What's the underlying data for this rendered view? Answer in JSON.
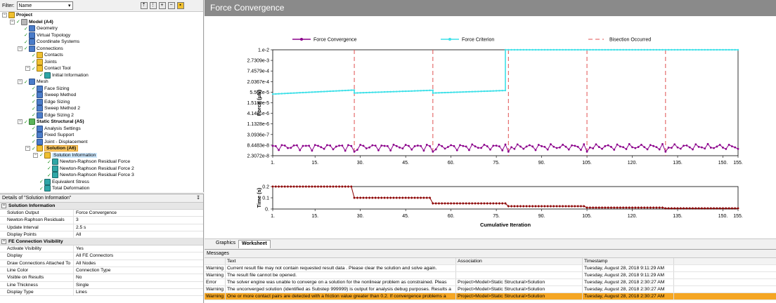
{
  "filter": {
    "label": "Filter:",
    "value": "Name"
  },
  "tree": [
    {
      "label": "Project",
      "depth": 0,
      "icon": "yellow",
      "bold": true
    },
    {
      "label": "Model (A4)",
      "depth": 1,
      "icon": "gray",
      "bold": true
    },
    {
      "label": "Geometry",
      "depth": 2,
      "icon": "blue"
    },
    {
      "label": "Virtual Topology",
      "depth": 2,
      "icon": "blue"
    },
    {
      "label": "Coordinate Systems",
      "depth": 2,
      "icon": "blue"
    },
    {
      "label": "Connections",
      "depth": 2,
      "icon": "blue"
    },
    {
      "label": "Contacts",
      "depth": 3,
      "icon": "yellow"
    },
    {
      "label": "Joints",
      "depth": 3,
      "icon": "yellow"
    },
    {
      "label": "Contact Tool",
      "depth": 3,
      "icon": "yellow"
    },
    {
      "label": "Initial Information",
      "depth": 4,
      "icon": "teal"
    },
    {
      "label": "Mesh",
      "depth": 2,
      "icon": "blue"
    },
    {
      "label": "Face Sizing",
      "depth": 3,
      "icon": "blue"
    },
    {
      "label": "Sweep Method",
      "depth": 3,
      "icon": "blue"
    },
    {
      "label": "Edge Sizing",
      "depth": 3,
      "icon": "blue"
    },
    {
      "label": "Sweep Method 2",
      "depth": 3,
      "icon": "blue"
    },
    {
      "label": "Edge Sizing 2",
      "depth": 3,
      "icon": "blue"
    },
    {
      "label": "Static Structural (A5)",
      "depth": 2,
      "icon": "green",
      "bold": true
    },
    {
      "label": "Analysis Settings",
      "depth": 3,
      "icon": "blue"
    },
    {
      "label": "Fixed Support",
      "depth": 3,
      "icon": "blue"
    },
    {
      "label": "Joint - Displacement",
      "depth": 3,
      "icon": "blue"
    },
    {
      "label": "Solution (A6)",
      "depth": 3,
      "icon": "yellow",
      "bold": true,
      "selected": true
    },
    {
      "label": "Solution Information",
      "depth": 4,
      "icon": "yellow",
      "highlight": true
    },
    {
      "label": "Newton-Raphson Residual Force",
      "depth": 5,
      "icon": "teal"
    },
    {
      "label": "Newton-Raphson Residual Force 2",
      "depth": 5,
      "icon": "teal"
    },
    {
      "label": "Newton-Raphson Residual Force 3",
      "depth": 5,
      "icon": "teal"
    },
    {
      "label": "Equivalent Stress",
      "depth": 4,
      "icon": "teal"
    },
    {
      "label": "Total Deformation",
      "depth": 4,
      "icon": "teal"
    }
  ],
  "details": {
    "title": "Details of \"Solution Information\"",
    "pin": "↧",
    "groups": [
      {
        "name": "Solution Information",
        "rows": [
          {
            "k": "Solution Output",
            "v": "Force Convergence"
          },
          {
            "k": "Newton-Raphson Residuals",
            "v": "3"
          },
          {
            "k": "Update Interval",
            "v": "2.5 s"
          },
          {
            "k": "Display Points",
            "v": "All"
          }
        ]
      },
      {
        "name": "FE Connection Visibility",
        "rows": [
          {
            "k": "Activate Visibility",
            "v": "Yes"
          },
          {
            "k": "Display",
            "v": "All FE Connectors"
          },
          {
            "k": "Draw Connections Attached To",
            "v": "All Nodes"
          },
          {
            "k": "Line Color",
            "v": "Connection Type"
          },
          {
            "k": "Visible on Results",
            "v": "No"
          },
          {
            "k": "Line Thickness",
            "v": "Single"
          },
          {
            "k": "Display Type",
            "v": "Lines"
          }
        ]
      }
    ]
  },
  "worksheet": {
    "title": "Force Convergence",
    "tabs": [
      "Graphics",
      "Worksheet"
    ],
    "active_tab": "Worksheet"
  },
  "chart_data": [
    {
      "type": "line",
      "title": "",
      "xlabel": "",
      "ylabel": "Force (μN)",
      "y_scale": "log",
      "ylim": [
        2.3072e-08,
        0.01
      ],
      "xlim": [
        1,
        155
      ],
      "x_ticks": [
        "1.",
        "15.",
        "30.",
        "45.",
        "60.",
        "75.",
        "90.",
        "105.",
        "120.",
        "135.",
        "150.",
        "155."
      ],
      "y_ticks": [
        "1.e-2",
        "2.7309e-3",
        "7.4579e-4",
        "2.0367e-4",
        "5.562e-5",
        "1.5189e-5",
        "4.1481e-6",
        "1.1328e-6",
        "3.0936e-7",
        "8.4483e-8",
        "2.3072e-8"
      ],
      "legend": [
        "Force Convergence",
        "Force Criterion",
        "Bisection Occurred"
      ],
      "legend_colors": [
        "#8b008b",
        "#3de0e8",
        "#e05050"
      ],
      "bisections": [
        28,
        54,
        79,
        105,
        131
      ],
      "series": [
        {
          "name": "Force Convergence",
          "color": "#8b008b",
          "segments": [
            {
              "from": 1,
              "to": 28,
              "level": 7e-08
            },
            {
              "from": 28,
              "to": 54,
              "level": 7e-08
            },
            {
              "from": 54,
              "to": 79,
              "level": 7e-08
            },
            {
              "from": 79,
              "to": 105,
              "level": 7e-08
            },
            {
              "from": 105,
              "to": 131,
              "level": 7e-08
            },
            {
              "from": 131,
              "to": 155,
              "level": 7e-08
            }
          ]
        },
        {
          "name": "Force Criterion",
          "color": "#3de0e8",
          "segments": [
            {
              "from": 1,
              "to": 28,
              "start": 4.4e-05,
              "end": 7.2e-05
            },
            {
              "from": 28,
              "to": 54,
              "start": 5e-05,
              "end": 7e-05
            },
            {
              "from": 54,
              "to": 78,
              "start": 5e-05,
              "end": 6.8e-05
            },
            {
              "from": 78,
              "to": 155,
              "start": 0.01,
              "end": 0.01
            }
          ]
        }
      ]
    },
    {
      "type": "line",
      "title": "",
      "xlabel": "Cumulative Iteration",
      "ylabel": "Time (s)",
      "ylim": [
        0,
        0.2
      ],
      "xlim": [
        1,
        155
      ],
      "x_ticks": [
        "1.",
        "15.",
        "30.",
        "45.",
        "60.",
        "75.",
        "90.",
        "105.",
        "120.",
        "135.",
        "150.",
        "155."
      ],
      "y_ticks": [
        "0.2",
        "0.1",
        "0."
      ],
      "series": [
        {
          "name": "Time",
          "color": "#8b0000",
          "steps": [
            {
              "from": 1,
              "to": 27,
              "value": 0.2
            },
            {
              "from": 28,
              "to": 53,
              "value": 0.1
            },
            {
              "from": 54,
              "to": 78,
              "value": 0.05
            },
            {
              "from": 79,
              "to": 104,
              "value": 0.025
            },
            {
              "from": 105,
              "to": 130,
              "value": 0.0125
            },
            {
              "from": 131,
              "to": 155,
              "value": 0.00625
            }
          ]
        }
      ]
    }
  ],
  "messages": {
    "title": "Messages",
    "columns": [
      "",
      "Text",
      "Association",
      "Timestamp"
    ],
    "rows": [
      {
        "type": "Warning",
        "text": "Current result file may not contain requested result data . Please clear the solution and solve again.",
        "assoc": "",
        "time": "Tuesday, August 28, 2018 9:11:29 AM"
      },
      {
        "type": "Warning",
        "text": "The result file  cannot be opened.",
        "assoc": "",
        "time": "Tuesday, August 28, 2018 9:11:29 AM"
      },
      {
        "type": "Error",
        "text": "The solver engine was unable to converge on a solution for the nonlinear problem as constrained.  Pleas",
        "assoc": "Project>Model>Static Structural>Solution",
        "time": "Tuesday, August 28, 2018 2:30:27 AM"
      },
      {
        "type": "Warning",
        "text": "The unconverged solution (identified as Substep 999999) is output for analysis debug purposes. Results a",
        "assoc": "Project>Model>Static Structural>Solution",
        "time": "Tuesday, August 28, 2018 2:30:27 AM"
      },
      {
        "type": "Warning",
        "text": " One or more contact pairs are detected with a friction value greater than 0.2. If convergence problems a",
        "assoc": "Project>Model>Static Structural>Solution",
        "time": "Tuesday, August 28, 2018 2:30:27 AM",
        "selected": true
      }
    ]
  }
}
